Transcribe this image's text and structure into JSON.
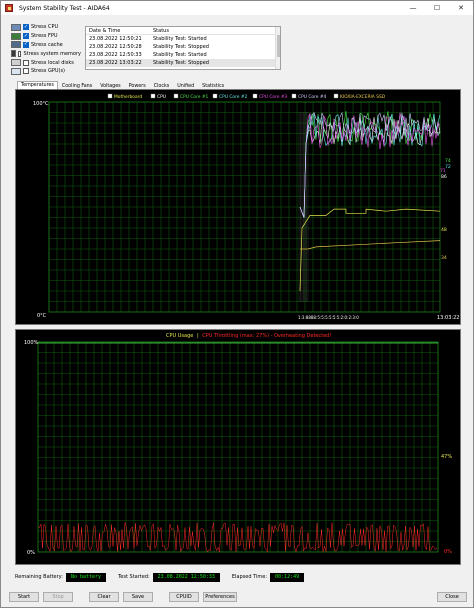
{
  "window": {
    "title": "System Stability Test - AIDA64",
    "minimize": "—",
    "maximize": "☐",
    "close": "✕"
  },
  "stress_options": [
    {
      "label": "Stress CPU",
      "checked": true,
      "icon": "cpu-icon"
    },
    {
      "label": "Stress FPU",
      "checked": true,
      "icon": "fpu-icon"
    },
    {
      "label": "Stress cache",
      "checked": true,
      "icon": "cache-icon"
    },
    {
      "label": "Stress system memory",
      "checked": false,
      "icon": "memory-icon"
    },
    {
      "label": "Stress local disks",
      "checked": false,
      "icon": "disk-icon"
    },
    {
      "label": "Stress GPU(s)",
      "checked": false,
      "icon": "gpu-icon"
    }
  ],
  "log": {
    "headers": [
      "Date & Time",
      "Status"
    ],
    "rows": [
      {
        "time": "23.08.2022 12:50:21",
        "status": "Stability Test: Started"
      },
      {
        "time": "23.08.2022 12:50:28",
        "status": "Stability Test: Stopped"
      },
      {
        "time": "23.08.2022 12:50:33",
        "status": "Stability Test: Started"
      },
      {
        "time": "23.08.2022 13:03:22",
        "status": "Stability Test: Stopped"
      }
    ]
  },
  "tabs": [
    "Temperatures",
    "Cooling Fans",
    "Voltages",
    "Powers",
    "Clocks",
    "Unified",
    "Statistics"
  ],
  "active_tab": "Temperatures",
  "temp_chart": {
    "legend": [
      {
        "label": "Motherboard",
        "color": "#e6e64d"
      },
      {
        "label": "CPU",
        "color": "#ffffff"
      },
      {
        "label": "CPU Core #1",
        "color": "#4de64d"
      },
      {
        "label": "CPU Core #2",
        "color": "#66e6e6"
      },
      {
        "label": "CPU Core #3",
        "color": "#e64de6"
      },
      {
        "label": "CPU Core #4",
        "color": "#d0d0ff"
      },
      {
        "label": "KIOXIA-EXCERIA SSD",
        "color": "#e6c84d"
      }
    ],
    "y_top": "100°C",
    "y_bottom": "0°C",
    "x_label_left": "1:3:8888:5:5:5:5:5:5:2:0:2:3:0",
    "x_label_right": "13:03:22",
    "right_values": [
      {
        "text": "86",
        "color": "#ffffff"
      },
      {
        "text": "74",
        "color": "#4de64d"
      },
      {
        "text": "72",
        "color": "#66e6e6"
      },
      {
        "text": "71",
        "color": "#e64de6"
      },
      {
        "text": "48",
        "color": "#e6e64d"
      },
      {
        "text": "34",
        "color": "#e6c84d"
      }
    ]
  },
  "usage_chart": {
    "title_main": "CPU Usage",
    "title_sep": "|",
    "title_alert": "CPU Throttling (max: 27%) - Overheating Detected!",
    "title_color": "#e6e64d",
    "alert_color": "#ff2a2a",
    "y_top": "100%",
    "y_bottom": "0%",
    "right_values": [
      {
        "text": "47%",
        "color": "#e6e64d"
      },
      {
        "text": "0%",
        "color": "#ff2a2a"
      }
    ]
  },
  "status_bar": {
    "remaining_battery_label": "Remaining Battery:",
    "remaining_battery_value": "No battery",
    "test_started_label": "Test Started:",
    "test_started_value": "23.08.2022 12:50:33",
    "elapsed_label": "Elapsed Time:",
    "elapsed_value": "00:12:49"
  },
  "buttons": {
    "start": "Start",
    "stop": "Stop",
    "clear": "Clear",
    "save": "Save",
    "cpuid": "CPUID",
    "preferences": "Preferences",
    "close": "Close"
  }
}
